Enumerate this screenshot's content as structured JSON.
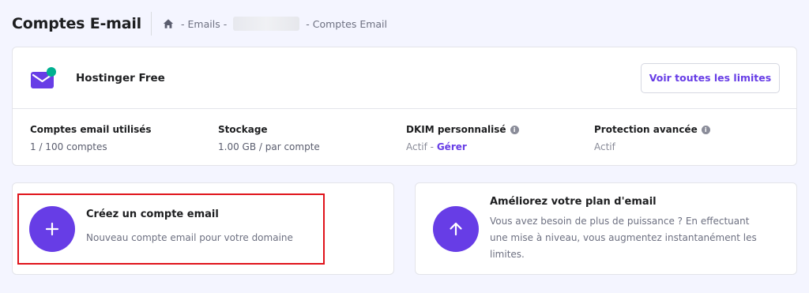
{
  "header": {
    "title": "Comptes E-mail",
    "breadcrumb": {
      "emails": "Emails",
      "separator": "-",
      "current": "Comptes Email"
    }
  },
  "plan": {
    "name": "Hostinger Free",
    "limits_button": "Voir toutes les limites",
    "stats": [
      {
        "label": "Comptes email utilisés",
        "value": "1 / 100 comptes"
      },
      {
        "label": "Stockage",
        "value": "1.00 GB / par compte"
      },
      {
        "label": "DKIM personnalisé",
        "value": "Actif",
        "action_sep": " - ",
        "action": "Gérer"
      },
      {
        "label": "Protection avancée",
        "value": "Actif"
      }
    ]
  },
  "create_card": {
    "title": "Créez un compte email",
    "description": "Nouveau compte email pour votre domaine"
  },
  "upgrade_card": {
    "title": "Améliorez votre plan d'email",
    "description": "Vous avez besoin de plus de puissance ? En effectuant une mise à niveau, vous augmentez instantanément les limites."
  },
  "colors": {
    "accent": "#673de6",
    "status_dot": "#00b090",
    "highlight": "#e0131b"
  },
  "icons": [
    "home-icon",
    "mail-icon",
    "info-icon",
    "plus-icon",
    "arrow-up-icon"
  ]
}
